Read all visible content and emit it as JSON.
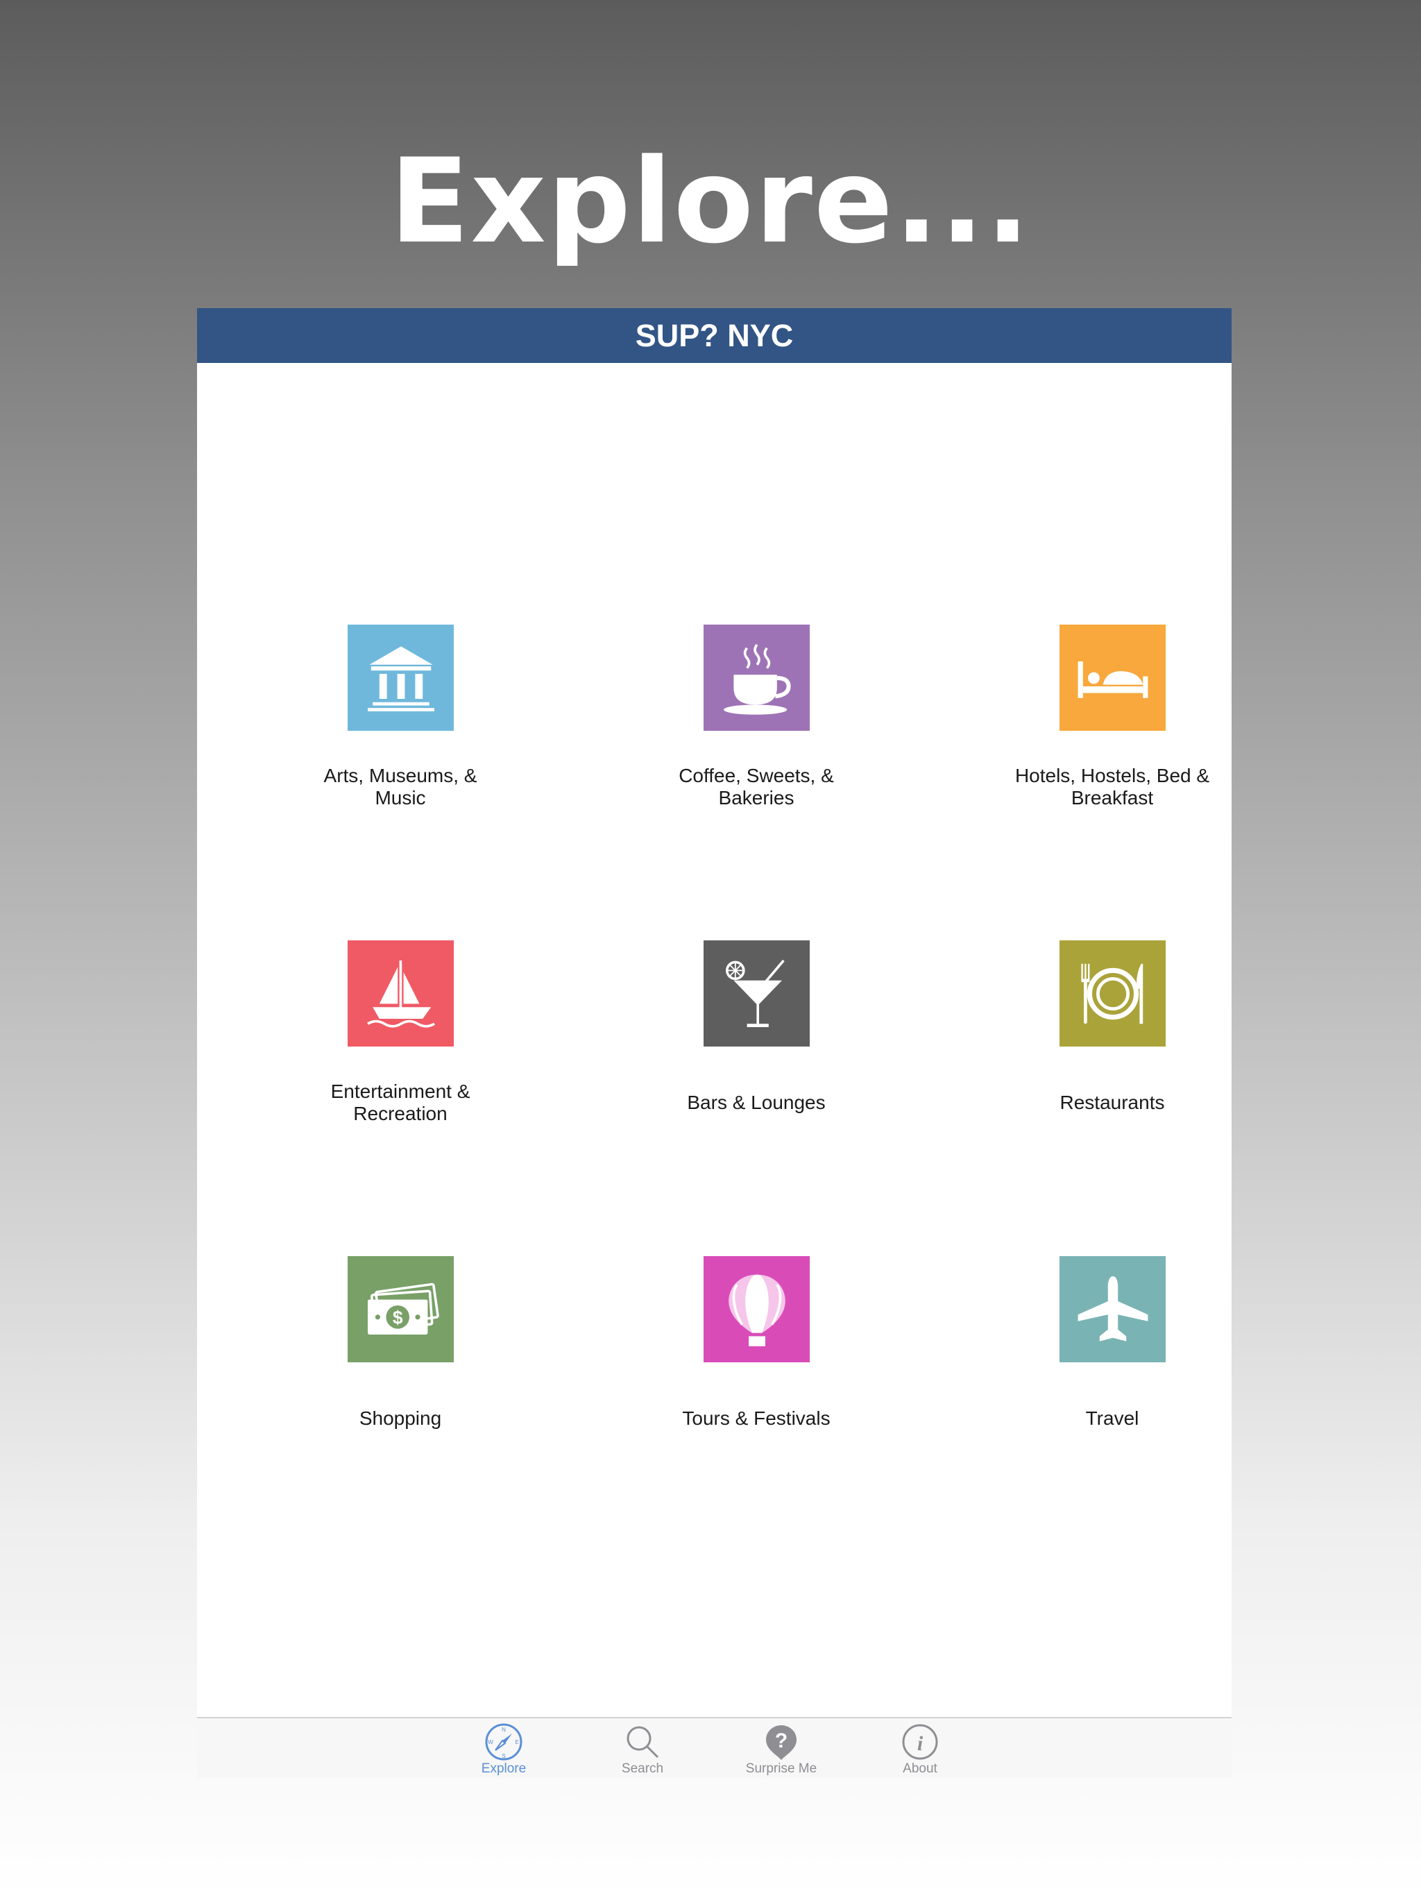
{
  "headline": "Explore...",
  "app": {
    "title": "SUP? NYC",
    "navbar_color": "#325585"
  },
  "categories": [
    {
      "label": "Arts, Museums, & Music",
      "icon": "museum-icon",
      "color": "#6fb8dc"
    },
    {
      "label": "Coffee, Sweets, & Bakeries",
      "icon": "coffee-cup-icon",
      "color": "#9e73b5"
    },
    {
      "label": "Hotels, Hostels, Bed & Breakfast",
      "icon": "bed-icon",
      "color": "#f8a83c"
    },
    {
      "label": "Entertainment & Recreation",
      "icon": "sailboat-icon",
      "color": "#f05a65"
    },
    {
      "label": "Bars & Lounges",
      "icon": "cocktail-icon",
      "color": "#5f5e5f"
    },
    {
      "label": "Restaurants",
      "icon": "plate-cutlery-icon",
      "color": "#aaa33a"
    },
    {
      "label": "Shopping",
      "icon": "money-icon",
      "color": "#78a067"
    },
    {
      "label": "Tours & Festivals",
      "icon": "hot-air-balloon-icon",
      "color": "#d94cb8"
    },
    {
      "label": "Travel",
      "icon": "airplane-icon",
      "color": "#7ab3b3"
    }
  ],
  "tabs": [
    {
      "label": "Explore",
      "icon": "compass-icon",
      "active": true
    },
    {
      "label": "Search",
      "icon": "magnifier-icon",
      "active": false
    },
    {
      "label": "Surprise Me",
      "icon": "question-pin-icon",
      "active": false
    },
    {
      "label": "About",
      "icon": "info-icon",
      "active": false
    }
  ],
  "colors": {
    "tab_active": "#5a8fd6",
    "tab_inactive": "#8e8e93"
  }
}
